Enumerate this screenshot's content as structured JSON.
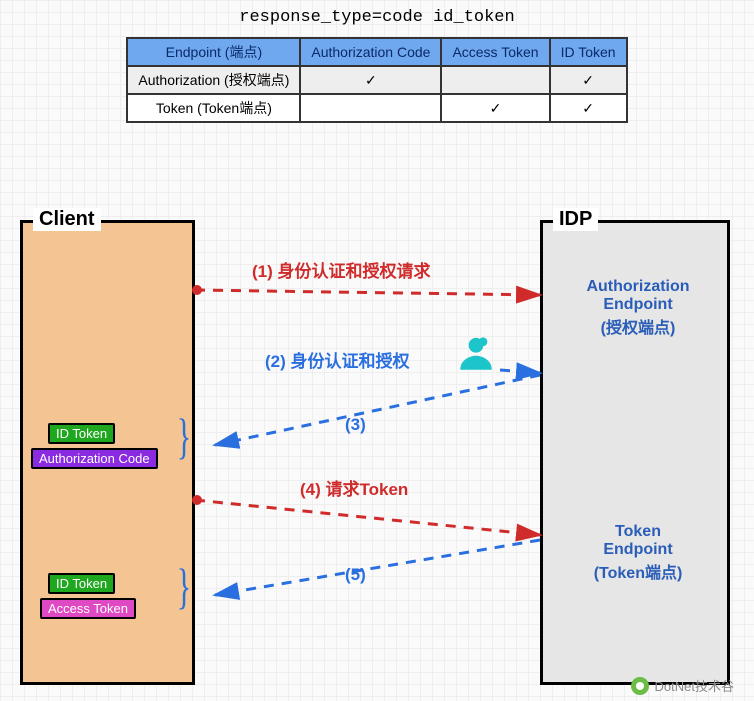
{
  "title": "response_type=code id_token",
  "table": {
    "headers": [
      "Endpoint (端点)",
      "Authorization Code",
      "Access Token",
      "ID Token"
    ],
    "rows": [
      {
        "label": "Authorization (授权端点)",
        "auth_code": "✓",
        "access_token": "",
        "id_token": "✓"
      },
      {
        "label": "Token (Token端点)",
        "auth_code": "",
        "access_token": "✓",
        "id_token": "✓"
      }
    ]
  },
  "client": {
    "label": "Client"
  },
  "idp": {
    "label": "IDP",
    "auth_endpoint": "Authorization Endpoint (授权端点)",
    "token_endpoint": "Token Endpoint (Token端点)"
  },
  "tags": {
    "id_token": "ID Token",
    "authorization_code": "Authorization Code",
    "access_token": "Access Token"
  },
  "steps": {
    "s1": "(1) 身份认证和授权请求",
    "s2": "(2) 身份认证和授权",
    "s3": "(3)",
    "s4": "(4) 请求Token",
    "s5": "(5)"
  },
  "watermark": "DotNet技术谷"
}
